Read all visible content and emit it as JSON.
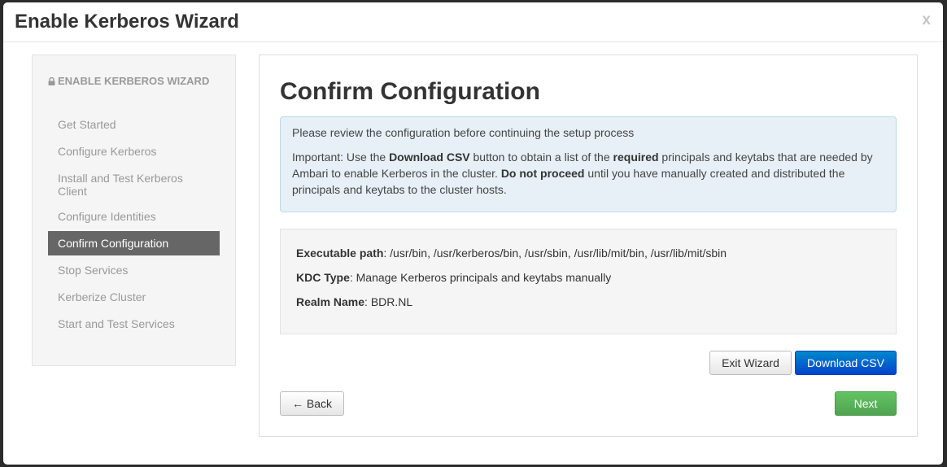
{
  "modal": {
    "title": "Enable Kerberos Wizard",
    "close_label": "x"
  },
  "sidebar": {
    "header": "ENABLE KERBEROS WIZARD",
    "items": [
      {
        "label": "Get Started",
        "active": false
      },
      {
        "label": "Configure Kerberos",
        "active": false
      },
      {
        "label": "Install and Test Kerberos Client",
        "active": false
      },
      {
        "label": "Configure Identities",
        "active": false
      },
      {
        "label": "Confirm Configuration",
        "active": true
      },
      {
        "label": "Stop Services",
        "active": false
      },
      {
        "label": "Kerberize Cluster",
        "active": false
      },
      {
        "label": "Start and Test Services",
        "active": false
      }
    ]
  },
  "main": {
    "title": "Confirm Configuration",
    "alert": {
      "line1": "Please review the configuration before continuing the setup process",
      "important_prefix": "Important: Use the ",
      "download_csv_bold": "Download CSV",
      "text_mid1": " button to obtain a list of the ",
      "required_bold": "required",
      "text_mid2": " principals and keytabs that are needed by Ambari to enable Kerberos in the cluster. ",
      "do_not_proceed_bold": "Do not proceed",
      "text_end": " until you have manually created and distributed the principals and keytabs to the cluster hosts."
    },
    "summary": {
      "executable_path_label": "Executable path",
      "executable_path_value": ": /usr/bin, /usr/kerberos/bin, /usr/sbin, /usr/lib/mit/bin, /usr/lib/mit/sbin",
      "kdc_type_label": "KDC Type",
      "kdc_type_value": ": Manage Kerberos principals and keytabs manually",
      "realm_name_label": "Realm Name",
      "realm_name_value": ": BDR.NL"
    },
    "buttons": {
      "exit_wizard": "Exit Wizard",
      "download_csv": "Download CSV",
      "back": "← Back",
      "next": "Next →"
    }
  },
  "colors": {
    "primary": "#0055cc",
    "success": "#5bb75b",
    "nav_active": "#666666",
    "alert_bg": "#e6f0f6"
  },
  "icons": {
    "sidebar_header": "lock-icon"
  }
}
